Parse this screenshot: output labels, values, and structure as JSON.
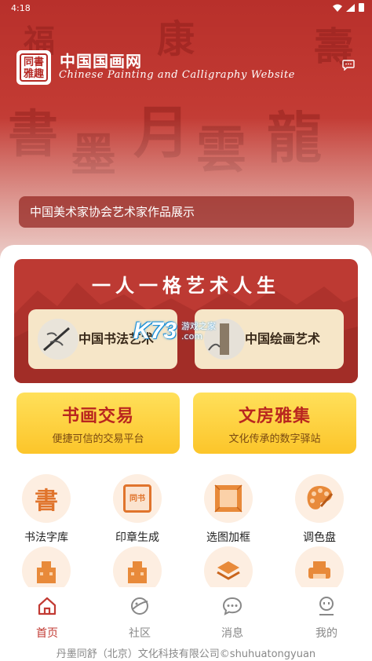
{
  "status_bar": {
    "time": "4:18"
  },
  "header": {
    "title": "中国国画网",
    "subtitle": "Chinese Painting and Calligraphy Website",
    "logo_text": "同書雅趣",
    "icons": {
      "message": "message-icon"
    }
  },
  "banner": {
    "caption": "中国美术家协会艺术家作品展示"
  },
  "art_section": {
    "slogan": "一人一格艺术人生",
    "cards": [
      {
        "label": "中国书法艺术"
      },
      {
        "label": "中国绘画艺术"
      }
    ]
  },
  "watermark": {
    "logo": "K73",
    "line1": "游戏之家",
    "line2": ".com"
  },
  "feature_buttons": [
    {
      "title": "书画交易",
      "subtitle": "便捷可信的交易平台"
    },
    {
      "title": "文房雅集",
      "subtitle": "文化传承的数字驿站"
    }
  ],
  "tools": [
    {
      "label": "书法字库",
      "icon": "calligraphy-char-icon",
      "glyph": "書"
    },
    {
      "label": "印章生成",
      "icon": "seal-stamp-icon",
      "glyph": "同书"
    },
    {
      "label": "选图加框",
      "icon": "picture-frame-icon"
    },
    {
      "label": "调色盘",
      "icon": "palette-icon"
    },
    {
      "label": "",
      "icon": "building-icon"
    },
    {
      "label": "",
      "icon": "building-icon"
    },
    {
      "label": "",
      "icon": "stack-icon"
    },
    {
      "label": "",
      "icon": "printer-icon"
    }
  ],
  "tabs": [
    {
      "label": "首页",
      "icon": "home-icon",
      "active": true
    },
    {
      "label": "社区",
      "icon": "planet-icon",
      "active": false
    },
    {
      "label": "消息",
      "icon": "chat-icon",
      "active": false
    },
    {
      "label": "我的",
      "icon": "profile-icon",
      "active": false
    }
  ],
  "footer": {
    "copyright": "丹墨同舒（北京）文化科技有限公司©shuhuatongyuan"
  },
  "colors": {
    "primary_red": "#c23a33",
    "gold": "#fcc52a",
    "cream": "#f6e6c8"
  }
}
